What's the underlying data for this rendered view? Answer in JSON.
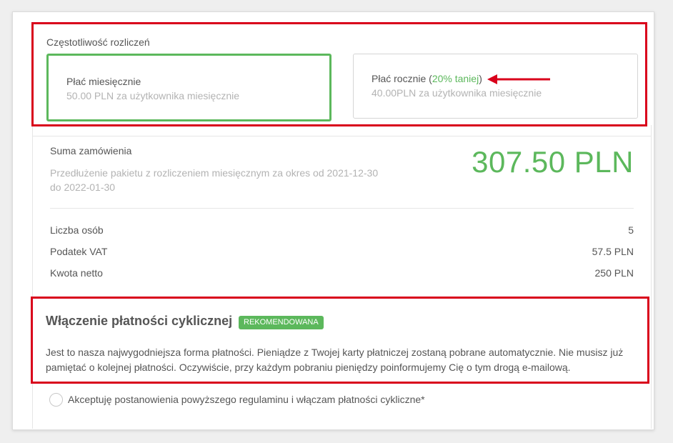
{
  "billing": {
    "frequency_label": "Częstotliwość rozliczeń",
    "monthly": {
      "title": "Płać miesięcznie",
      "subtitle": "50.00 PLN za użytkownika miesięcznie",
      "selected": true
    },
    "yearly": {
      "title_prefix": "Płać rocznie (",
      "discount": "20% taniej",
      "title_suffix": ")",
      "subtitle": "40.00PLN za użytkownika miesięcznie",
      "selected": false
    }
  },
  "summary": {
    "label": "Suma zamówienia",
    "description": "Przedłużenie pakietu z rozliczeniem miesięcznym za okres od 2021-12-30 do 2022-01-30",
    "total": "307.50 PLN",
    "rows": [
      {
        "label": "Liczba osób",
        "value": "5"
      },
      {
        "label": "Podatek VAT",
        "value": "57.5 PLN"
      },
      {
        "label": "Kwota netto",
        "value": "250 PLN"
      }
    ]
  },
  "recurring": {
    "title": "Włączenie płatności cyklicznej",
    "badge": "REKOMENDOWANA",
    "description": "Jest to nasza najwygodniejsza forma płatności. Pieniądze z Twojej karty płatniczej zostaną pobrane automatycznie. Nie musisz już pamiętać o kolejnej płatności. Oczywiście, przy każdym pobraniu pieniędzy poinformujemy Cię o tym drogą e-mailową.",
    "accept_label": "Akceptuję postanowienia powyższego regulaminu i włączam płatności cykliczne*",
    "accepted": false
  },
  "colors": {
    "accent_green": "#5cb85c",
    "highlight_red": "#d9001b"
  }
}
